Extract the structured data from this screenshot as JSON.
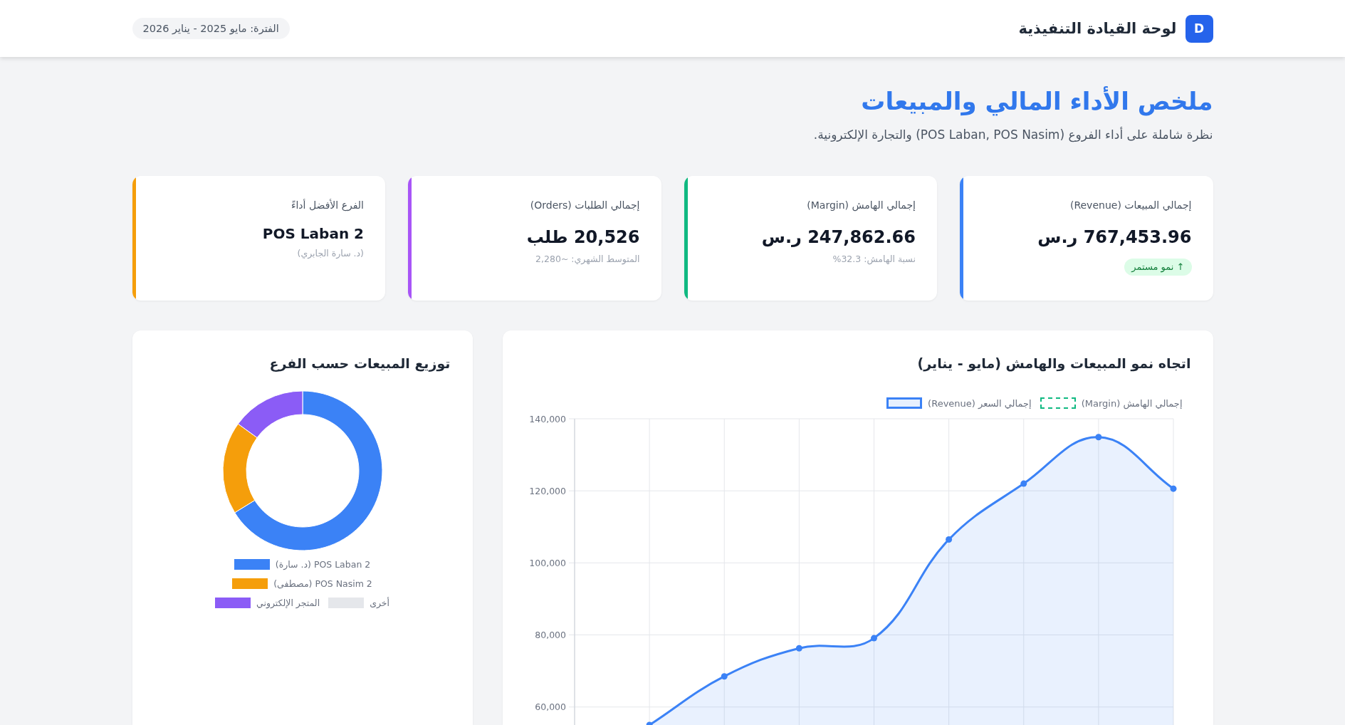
{
  "header": {
    "logo": "D",
    "title": "لوحة القيادة التنفيذية",
    "period": "الفترة: مايو 2025 - يناير 2026"
  },
  "page": {
    "title": "ملخص الأداء المالي والمبيعات",
    "subtitle": "نظرة شاملة على أداء الفروع (POS Laban, POS Nasim) والتجارة الإلكترونية."
  },
  "kpis": [
    {
      "kind": "trend",
      "label": "إجمالي المبيعات (Revenue)",
      "value": "767,453.96 ر.س",
      "note": "↑ نمو مستمر",
      "color": "#3b82f6"
    },
    {
      "kind": "metric",
      "label": "إجمالي الهامش (Margin)",
      "value": "247,862.66 ر.س",
      "note": "نسبة الهامش: 32.3%",
      "color": "#10b981"
    },
    {
      "kind": "metric",
      "label": "إجمالي الطلبات (Orders)",
      "value": "20,526 طلب",
      "note": "المتوسط الشهري: ~2,280",
      "color": "#a855f7"
    },
    {
      "kind": "leader",
      "label": "الفرع الأفضل أداءً",
      "value": "POS Laban 2",
      "note": "(د. سارة الجابري)",
      "color": "#f59e0b"
    }
  ],
  "sales_trend": {
    "title": "اتجاه نمو المبيعات والهامش (مايو - يناير)",
    "chart_data": {
      "type": "area",
      "grid": true,
      "series": [
        {
          "name": "إجمالي الهامش (Margin)",
          "color": "#10b981"
        },
        {
          "name": "إجمالي السعر (Revenue)",
          "color": "#3b82f6",
          "marker": "circle",
          "values": [
            null,
            55000,
            68500,
            76300,
            79100,
            106500,
            122000,
            134900,
            120600
          ]
        }
      ],
      "ylim": [
        55000,
        140000
      ],
      "yticks": [
        {
          "value": 140000,
          "label": "140,000"
        },
        {
          "value": 120000,
          "label": "120,000"
        },
        {
          "value": 100000,
          "label": "100,000"
        },
        {
          "value": 80000,
          "label": "80,000"
        },
        {
          "value": 60000,
          "label": "60,000"
        }
      ]
    }
  },
  "branch_sales": {
    "title": "توزيع المبيعات حسب الفرع",
    "chart_data": {
      "type": "donut",
      "categories": [
        "POS Laban 2 (د. سارة)",
        "POS Nasim 2 (مصطفى)",
        "أخرى",
        "المتجر الإلكتروني"
      ],
      "values": [
        66.2,
        18.8,
        0,
        15
      ],
      "colors": [
        "#3b82f6",
        "#f59e0b",
        "#e5e7eb",
        "#8b5cf6"
      ]
    }
  }
}
